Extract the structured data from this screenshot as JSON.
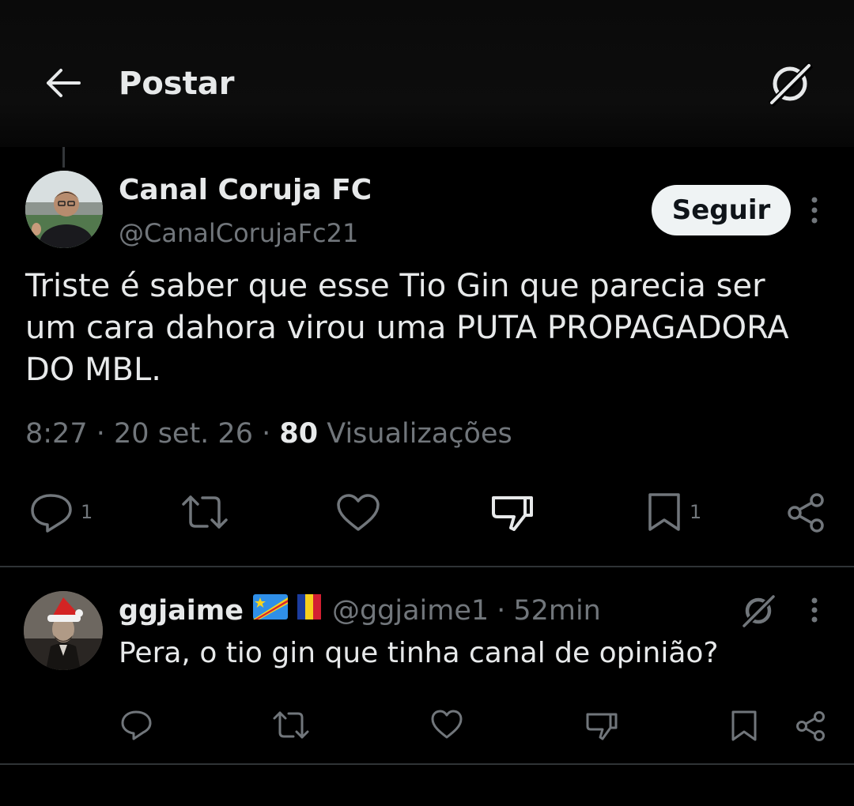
{
  "header": {
    "title": "Postar",
    "back_icon": "arrow-left-icon",
    "grok_icon": "grok-icon"
  },
  "post": {
    "author": {
      "name": "Canal Coruja FC",
      "handle": "@CanalCorujaFc21"
    },
    "follow_label": "Seguir",
    "text_lines": [
      "Triste é saber que esse Tio Gin que parecia ser",
      "um cara dahora virou uma PUTA PROPAGADORA",
      "DO MBL."
    ],
    "time": "8:27",
    "date": "20 set. 26",
    "separator": "·",
    "views_count": "80",
    "views_label": "Visualizações",
    "actions": {
      "reply_count": "1",
      "bookmark_count": "1"
    }
  },
  "reply": {
    "name": "ggjaime",
    "flags": [
      "congo-flag-icon",
      "romania-flag-icon"
    ],
    "handle": "@ggjaime1",
    "separator": "·",
    "time": "52min",
    "text": "Pera, o tio gin que tinha canal de opinião?"
  },
  "colors": {
    "background": "#000000",
    "primary_text": "#e7e9ea",
    "secondary_text": "#71767b",
    "divider": "#2f3336",
    "follow_button_bg": "#eff3f4"
  }
}
